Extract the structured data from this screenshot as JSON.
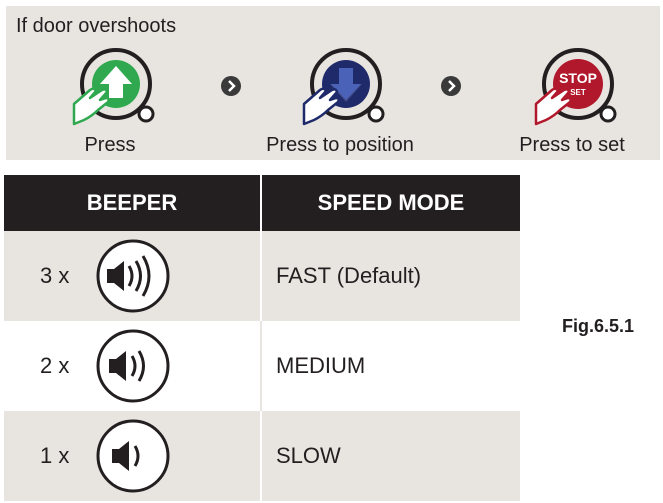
{
  "panel": {
    "title": "If door overshoots",
    "steps": [
      {
        "label": "Press",
        "icon": "up-arrow-button-icon",
        "color": "#2fa84f"
      },
      {
        "label": "Press to position",
        "icon": "down-arrow-button-icon",
        "color": "#1f2a6b"
      },
      {
        "label": "Press to set",
        "icon": "stop-set-button-icon",
        "color": "#b2182b",
        "button_text": "STOP",
        "button_subtext": "SET"
      }
    ]
  },
  "table": {
    "headers": {
      "beeper": "BEEPER",
      "speed_mode": "SPEED MODE"
    },
    "rows": [
      {
        "count": "3 x",
        "waves": 3,
        "speed": "FAST (Default)"
      },
      {
        "count": "2 x",
        "waves": 2,
        "speed": "MEDIUM"
      },
      {
        "count": "1 x",
        "waves": 1,
        "speed": "SLOW"
      }
    ]
  },
  "figure_label": "Fig.6.5.1",
  "colors": {
    "dark": "#231f20",
    "panel_bg": "#e8e5e0",
    "green": "#2fa84f",
    "navy": "#1f2a6b",
    "red": "#b2182b"
  }
}
